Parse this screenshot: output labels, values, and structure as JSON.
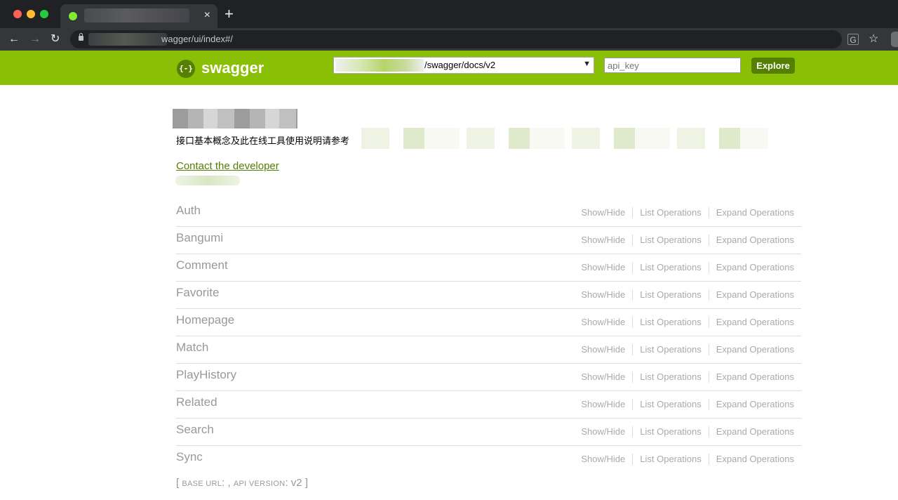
{
  "browser": {
    "url_visible": "wagger/ui/index#/",
    "new_tab_label": "+",
    "close_tab_label": "×"
  },
  "header": {
    "logo_text": "swagger",
    "logo_mark": "{-}",
    "select_url": "/swagger/docs/v2",
    "api_key_placeholder": "api_key",
    "explore_label": "Explore",
    "brand_color": "#89bf04",
    "dark_green": "#547f00"
  },
  "info": {
    "description": "接口基本概念及此在线工具使用说明请参考",
    "contact_link": "Contact the developer"
  },
  "resources": [
    {
      "name": "Auth"
    },
    {
      "name": "Bangumi"
    },
    {
      "name": "Comment"
    },
    {
      "name": "Favorite"
    },
    {
      "name": "Homepage"
    },
    {
      "name": "Match"
    },
    {
      "name": "PlayHistory"
    },
    {
      "name": "Related"
    },
    {
      "name": "Search"
    },
    {
      "name": "Sync"
    }
  ],
  "ops": {
    "show_hide": "Show/Hide",
    "list_operations": "List Operations",
    "expand_operations": "Expand Operations"
  },
  "footer": {
    "open_bracket": "[",
    "base_url_label": "BASE URL",
    "base_url_value": ": ,",
    "api_version_label": "API VERSION",
    "api_version_value": ": v2",
    "close_bracket": "]"
  }
}
